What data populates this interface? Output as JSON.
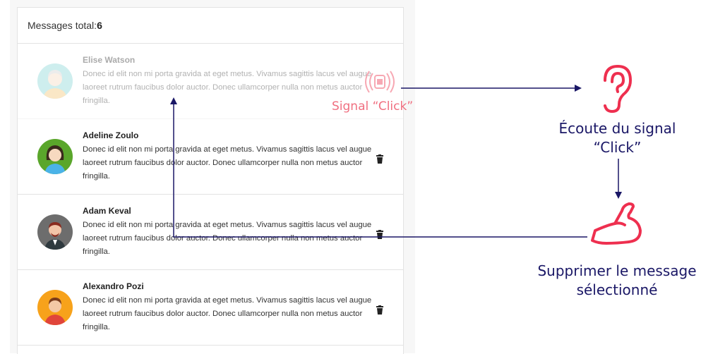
{
  "header": {
    "label": "Messages total:",
    "count": "6"
  },
  "messages": [
    {
      "name": "Elise Watson",
      "text": "Donec id elit non mi porta gravida at eget metus. Vivamus sagittis lacus vel augue laoreet rutrum faucibus dolor auctor. Donec ullamcorper nulla non metus auctor fringilla.",
      "faded": true
    },
    {
      "name": "Adeline Zoulo",
      "text": "Donec id elit non mi porta gravida at eget metus. Vivamus sagittis lacus vel augue laoreet rutrum faucibus dolor auctor. Donec ullamcorper nulla non metus auctor fringilla.",
      "faded": false
    },
    {
      "name": "Adam Keval",
      "text": "Donec id elit non mi porta gravida at eget metus. Vivamus sagittis lacus vel augue laoreet rutrum faucibus dolor auctor. Donec ullamcorper nulla non metus auctor fringilla.",
      "faded": false
    },
    {
      "name": "Alexandro Pozi",
      "text": "Donec id elit non mi porta gravida at eget metus. Vivamus sagittis lacus vel augue laoreet rutrum faucibus dolor auctor. Donec ullamcorper nulla non metus auctor fringilla.",
      "faded": false
    }
  ],
  "diagram": {
    "signal_click": "Signal “Click”",
    "listen": "Écoute du signal “Click”",
    "delete": "Supprimer le message sélectionné"
  },
  "icons": {
    "signal": "signal-icon",
    "ear": "ear-icon",
    "arm": "flexed-arm-icon",
    "trash": "trash-icon"
  },
  "colors": {
    "accent_red": "#ee2f4f",
    "arrow": "#1a1766",
    "signal_text": "#f06f80"
  }
}
